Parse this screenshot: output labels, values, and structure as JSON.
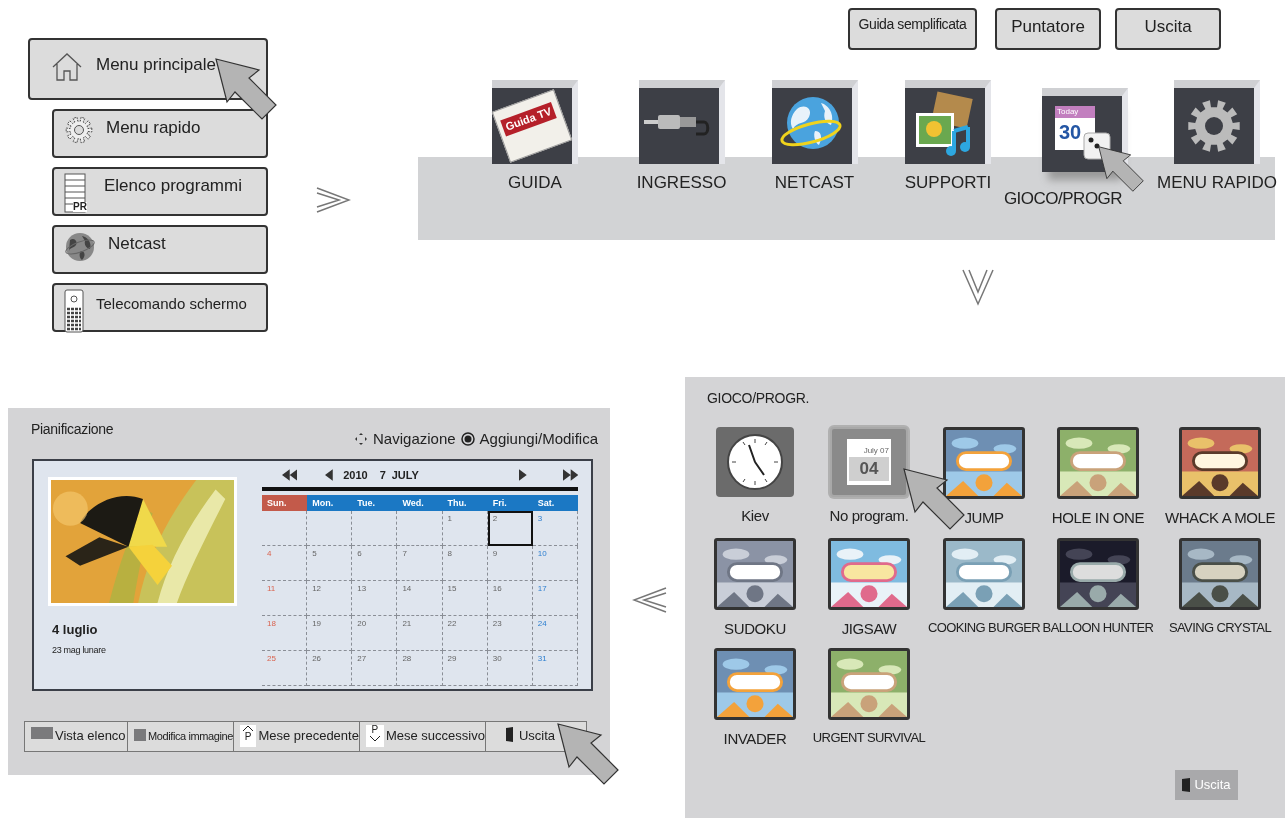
{
  "quick_menu": {
    "items": [
      {
        "label": "Menu principale",
        "kind": "home",
        "selected": true
      },
      {
        "label": "Menu rapido",
        "kind": "gear",
        "selected": false
      },
      {
        "label": "Elenco programmi",
        "kind": "list",
        "icon_text": "PR",
        "selected": false
      },
      {
        "label": "Netcast",
        "kind": "globe",
        "selected": false
      },
      {
        "label": "Telecomando schermo",
        "kind": "remote",
        "selected": false
      }
    ]
  },
  "home_menu": {
    "buttons": [
      "Guida semplificata",
      "Puntatore",
      "Uscita"
    ],
    "tiles": [
      {
        "label": "GUIDA",
        "kind": "guide",
        "icon_text": "Guida TV",
        "selected": false
      },
      {
        "label": "INGRESSO",
        "kind": "input",
        "selected": false
      },
      {
        "label": "NETCAST",
        "kind": "globe",
        "selected": false
      },
      {
        "label": "SUPPORTI",
        "kind": "media",
        "selected": false
      },
      {
        "label": "GIOCO/PROGR",
        "kind": "calendar",
        "icon_label": "Today",
        "icon_day": "30",
        "selected": true
      },
      {
        "label": "MENU RAPIDO",
        "kind": "gear",
        "selected": false
      }
    ]
  },
  "games": {
    "title": "GIOCO/PROGR.",
    "items": [
      {
        "label": "Kiev",
        "kind": "clock",
        "selected": false
      },
      {
        "label": "No program.",
        "kind": "calendar",
        "icon_label": "July 07",
        "icon_day": "04",
        "selected": true
      },
      {
        "label": "JUMP",
        "kind": "picture",
        "selected": false
      },
      {
        "label": "HOLE IN ONE",
        "kind": "picture",
        "selected": false
      },
      {
        "label": "WHACK A MOLE",
        "kind": "picture",
        "selected": false
      },
      {
        "label": "SUDOKU",
        "kind": "picture",
        "selected": false
      },
      {
        "label": "JIGSAW",
        "kind": "picture",
        "selected": false
      },
      {
        "label": "COOKING BURGER",
        "kind": "picture",
        "selected": false
      },
      {
        "label": "BALLOON HUNTER",
        "kind": "picture",
        "selected": false
      },
      {
        "label": "SAVING CRYSTAL",
        "kind": "picture",
        "selected": false
      },
      {
        "label": "INVADER",
        "kind": "picture",
        "selected": false
      },
      {
        "label": "URGENT SURVIVAL",
        "kind": "picture",
        "selected": false
      }
    ],
    "exit": "Uscita"
  },
  "scheduler": {
    "title": "Pianificazione",
    "hints": [
      {
        "kind": "nav",
        "label": "Navigazione"
      },
      {
        "kind": "ok",
        "label": "Aggiungi/Modifica"
      }
    ],
    "date": "4 luglio",
    "lunar_date": "23 mag lunare",
    "calendar": {
      "year": "2010",
      "month_number": "7",
      "month": "JULY",
      "weekdays": [
        "Sun.",
        "Mon.",
        "Tue.",
        "Wed.",
        "Thu.",
        "Fri.",
        "Sat."
      ],
      "weeks": [
        [
          {
            "day": "1",
            "selected": false
          },
          {
            "day": "2",
            "selected": true
          },
          {
            "day": "3",
            "selected": false
          }
        ],
        [
          {
            "day": "4",
            "selected": false
          },
          {
            "day": "5",
            "selected": false
          },
          {
            "day": "6",
            "selected": false
          },
          {
            "day": "7",
            "selected": false
          },
          {
            "day": "8",
            "selected": false
          },
          {
            "day": "9",
            "selected": false
          },
          {
            "day": "10",
            "selected": false
          }
        ],
        [
          {
            "day": "11",
            "selected": false
          },
          {
            "day": "12",
            "selected": false
          },
          {
            "day": "13",
            "selected": false
          },
          {
            "day": "14",
            "selected": false
          },
          {
            "day": "15",
            "selected": false
          },
          {
            "day": "16",
            "selected": false
          },
          {
            "day": "17",
            "selected": false
          }
        ],
        [
          {
            "day": "18",
            "selected": false
          },
          {
            "day": "19",
            "selected": false
          },
          {
            "day": "20",
            "selected": false
          },
          {
            "day": "21",
            "selected": false
          },
          {
            "day": "22",
            "selected": false
          },
          {
            "day": "23",
            "selected": false
          },
          {
            "day": "24",
            "selected": false
          }
        ],
        [
          {
            "day": "25",
            "selected": false
          },
          {
            "day": "26",
            "selected": false
          },
          {
            "day": "27",
            "selected": false
          },
          {
            "day": "28",
            "selected": false
          },
          {
            "day": "29",
            "selected": false
          },
          {
            "day": "30",
            "selected": false
          },
          {
            "day": "31",
            "selected": false
          }
        ]
      ]
    },
    "footer": [
      {
        "kind": "color",
        "label": "Vista elenco"
      },
      {
        "kind": "color",
        "label": "Modifica immagine"
      },
      {
        "kind": "ch_up",
        "key": "P",
        "label": "Mese precedente"
      },
      {
        "kind": "ch_down",
        "key": "P",
        "label": "Mese successivo"
      },
      {
        "kind": "exit",
        "label": "Uscita"
      }
    ]
  }
}
